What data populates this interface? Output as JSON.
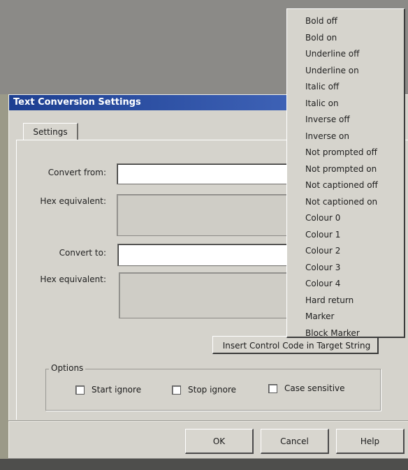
{
  "dialog": {
    "title": "Text Conversion Settings",
    "tab_label": "Settings",
    "convert_from_label": "Convert from:",
    "convert_from_value": "",
    "hex_equivalent_label_1": "Hex equivalent:",
    "convert_to_label": "Convert to:",
    "convert_to_value": "",
    "hex_equivalent_label_2": "Hex equivalent:",
    "insert_button_label": "Insert Control Code in Target String",
    "options_label": "Options",
    "options": [
      {
        "label": "Start ignore",
        "checked": false
      },
      {
        "label": "Stop ignore",
        "checked": false
      },
      {
        "label": "Case sensitive",
        "checked": false
      }
    ],
    "ok_label": "OK",
    "cancel_label": "Cancel",
    "help_label": "Help"
  },
  "control_code_menu": {
    "items": [
      "Bold off",
      "Bold on",
      "Underline off",
      "Underline on",
      "Italic off",
      "Italic on",
      "Inverse off",
      "Inverse on",
      "Not prompted off",
      "Not prompted on",
      "Not captioned off",
      "Not captioned on",
      "Colour 0",
      "Colour 1",
      "Colour 2",
      "Colour 3",
      "Colour 4",
      "Hard return",
      "Marker",
      "Block Marker"
    ]
  },
  "colors": {
    "titlebar": "#1d3f91",
    "dialog_face": "#d5d3cc"
  }
}
